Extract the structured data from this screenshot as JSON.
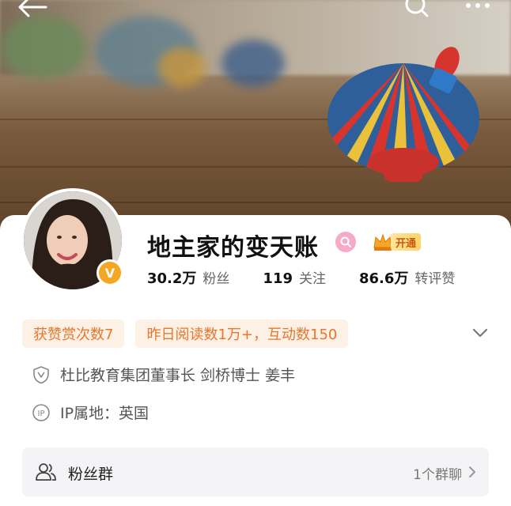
{
  "header": {
    "back_icon": "arrow-left-icon",
    "search_icon": "search-icon",
    "more_icon": "more-dots-icon"
  },
  "profile": {
    "name": "地主家的变天账",
    "vip_label": "开通",
    "stats": [
      {
        "value": "30.2万",
        "label": "粉丝"
      },
      {
        "value": "119",
        "label": "关注"
      },
      {
        "value": "86.6万",
        "label": "转评赞"
      }
    ],
    "tags": [
      "获赞赏次数7",
      "昨日阅读数1万+，互动数150"
    ],
    "verification": "杜比教育集团董事长 剑桥博士 姜丰",
    "ip_location": "IP属地：英国"
  },
  "fan_group": {
    "title": "粉丝群",
    "meta": "1个群聊"
  },
  "colors": {
    "accent_orange": "#e8762c",
    "tag_bg": "#fdf1e6",
    "verify_gold": "#f5a623"
  }
}
